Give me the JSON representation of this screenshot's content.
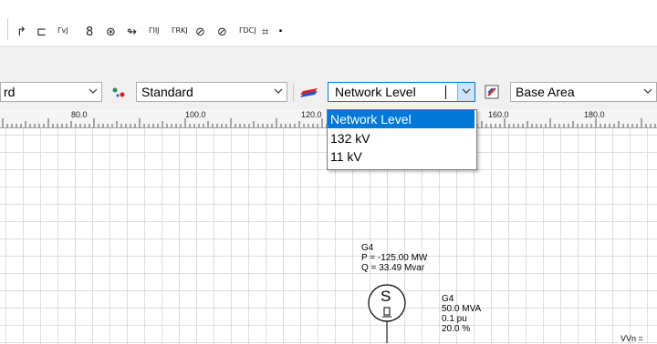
{
  "combo_left": {
    "value": "rd"
  },
  "combo_style": {
    "value": "Standard"
  },
  "combo_network": {
    "value": "Network Level"
  },
  "combo_area": {
    "value": "Base Area"
  },
  "dropdown": {
    "options": [
      "Network Level",
      "132 kV",
      "11 kV"
    ],
    "selected_index": 0
  },
  "ruler": {
    "labels": [
      "80.0",
      "100.0",
      "120.0",
      "160.0",
      "180.0"
    ]
  },
  "generator": {
    "name": "G4",
    "p": "P = -125.00 MW",
    "q": "Q = 33.49 Mvar",
    "symbol": "S",
    "rating": "50.0 MVA",
    "xd": "0.1 pu",
    "pct": "20.0 %"
  },
  "edge_text": "VVn =",
  "colors": {
    "accent": "#0078d7",
    "grid": "#dedede"
  }
}
